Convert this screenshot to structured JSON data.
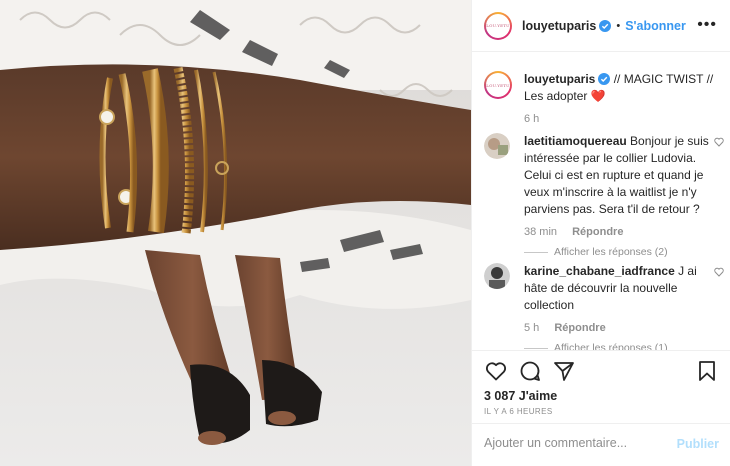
{
  "post": {
    "username": "louyetuparis",
    "follow_label": "S'abonner",
    "separator": "•",
    "more_label": "•••",
    "logo_text": "LOU.YETU"
  },
  "caption": {
    "username": "louyetuparis",
    "text": "// MAGIC TWIST // Les adopter ❤️",
    "time": "6 h"
  },
  "comments": [
    {
      "username": "laetitiamoquereau",
      "text": "Bonjour je suis intéressée par le collier Ludovia. Celui ci est en rupture et quand je veux m'inscrire à la waitlist je n'y parviens pas. Sera t'il de retour ?",
      "time": "38 min",
      "reply_label": "Répondre",
      "replies_label": "Afficher les réponses (2)"
    },
    {
      "username": "karine_chabane_iadfrance",
      "text": "J ai hâte de découvrir la nouvelle collection",
      "time": "5 h",
      "reply_label": "Répondre",
      "replies_label": "Afficher les réponses (1)"
    }
  ],
  "actions": {
    "likes": "3 087 J'aime",
    "timestamp": "IL Y A 6 HEURES"
  },
  "composer": {
    "placeholder": "Ajouter un commentaire...",
    "publish_label": "Publier"
  },
  "colors": {
    "link": "#3897f0",
    "verified": "#3897f0",
    "heart": "#ed4956",
    "muted": "#8e8e8e",
    "publish_disabled": "#b2dffc"
  }
}
